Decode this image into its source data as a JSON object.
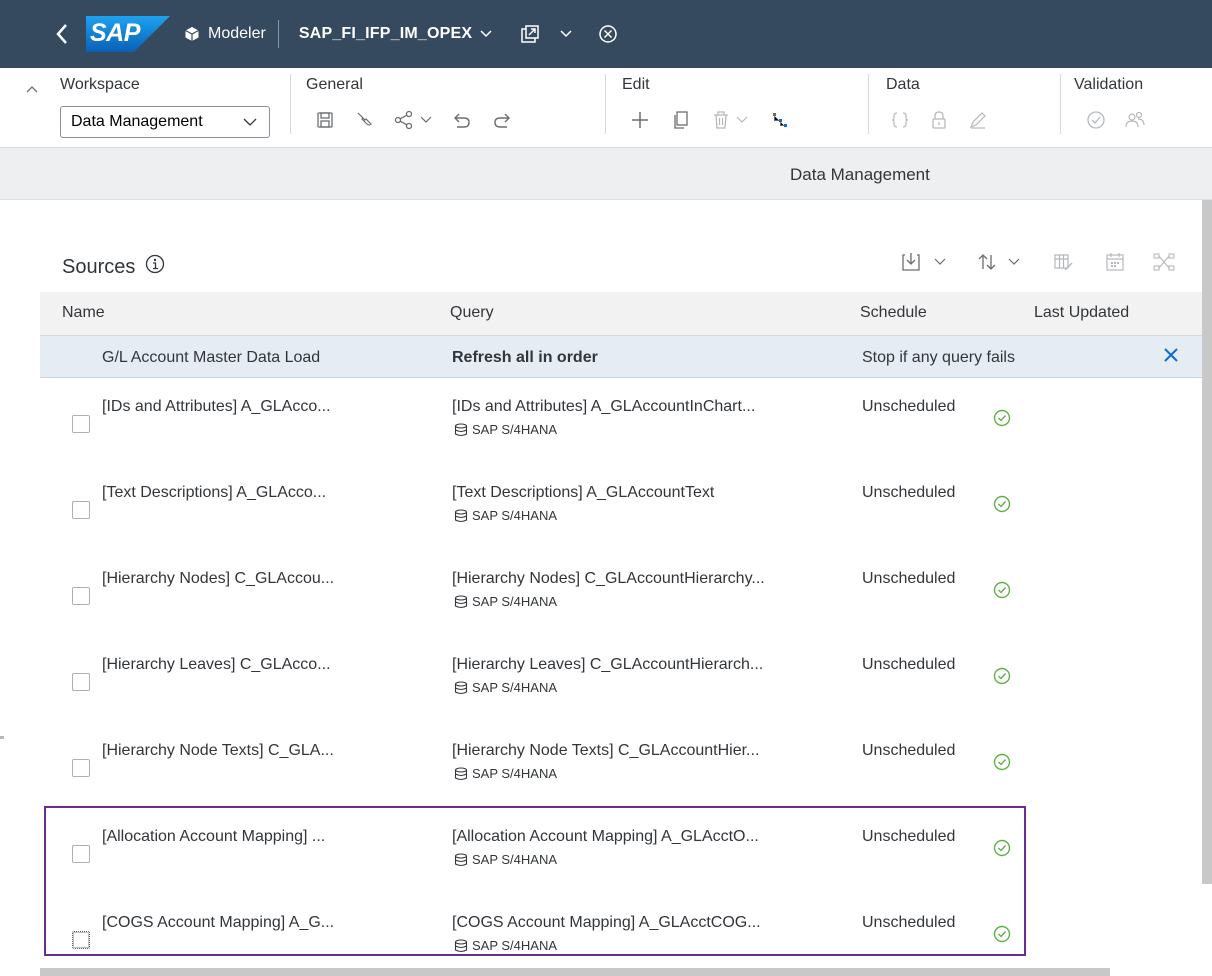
{
  "shell": {
    "logo_text": "SAP",
    "app_name": "Modeler",
    "model_name": "SAP_FI_IFP_IM_OPEX"
  },
  "toolbar": {
    "workspace_label": "Workspace",
    "workspace_value": "Data Management",
    "general_label": "General",
    "edit_label": "Edit",
    "data_label": "Data",
    "validation_label": "Validation"
  },
  "subheader": {
    "title": "Data Management"
  },
  "sources": {
    "title": "Sources",
    "columns": [
      "Name",
      "Query",
      "Schedule",
      "Last Updated"
    ],
    "group": {
      "name": "G/L Account Master Data Load",
      "query": "Refresh all in order",
      "schedule": "Stop if any query fails"
    },
    "rows": [
      {
        "name": "[IDs and Attributes] A_GLAcco...",
        "query": "[IDs and Attributes] A_GLAccountInChart...",
        "connection": "SAP S/4HANA",
        "schedule": "Unscheduled"
      },
      {
        "name": "[Text Descriptions] A_GLAcco...",
        "query": "[Text Descriptions] A_GLAccountText",
        "connection": "SAP S/4HANA",
        "schedule": "Unscheduled"
      },
      {
        "name": "[Hierarchy Nodes] C_GLAccou...",
        "query": "[Hierarchy Nodes] C_GLAccountHierarchy...",
        "connection": "SAP S/4HANA",
        "schedule": "Unscheduled"
      },
      {
        "name": "[Hierarchy Leaves] C_GLAcco...",
        "query": "[Hierarchy Leaves] C_GLAccountHierarch...",
        "connection": "SAP S/4HANA",
        "schedule": "Unscheduled"
      },
      {
        "name": "[Hierarchy Node Texts] C_GLA...",
        "query": "[Hierarchy Node Texts] C_GLAccountHier...",
        "connection": "SAP S/4HANA",
        "schedule": "Unscheduled"
      },
      {
        "name": "[Allocation Account Mapping] ...",
        "query": "[Allocation Account Mapping] A_GLAcctO...",
        "connection": "SAP S/4HANA",
        "schedule": "Unscheduled"
      },
      {
        "name": "[COGS Account Mapping] A_G...",
        "query": "[COGS Account Mapping] A_GLAcctCOG...",
        "connection": "SAP S/4HANA",
        "schedule": "Unscheduled"
      }
    ]
  },
  "colors": {
    "shell_bg": "#354a5f",
    "accent_blue": "#0a6ed1",
    "success_green": "#5fb146",
    "highlight_purple": "#6b2c91"
  }
}
